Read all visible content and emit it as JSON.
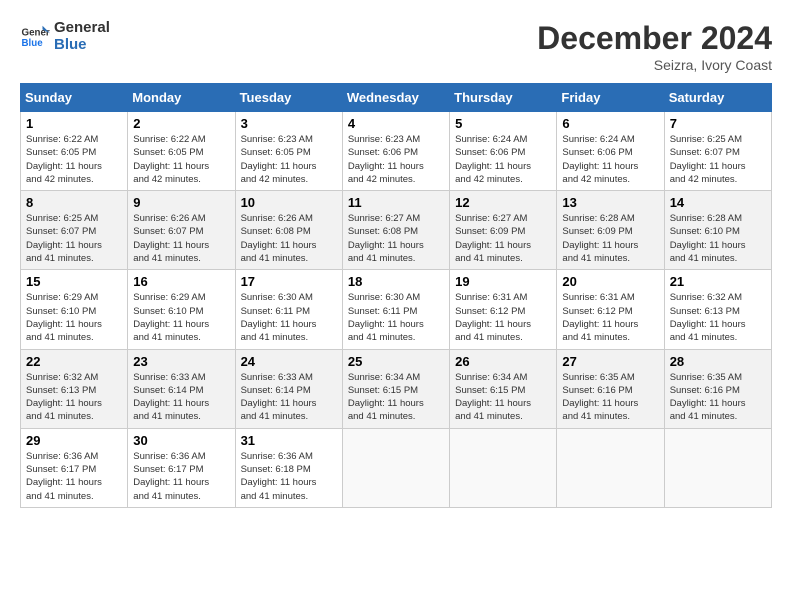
{
  "logo": {
    "line1": "General",
    "line2": "Blue"
  },
  "title": "December 2024",
  "location": "Seizra, Ivory Coast",
  "days_of_week": [
    "Sunday",
    "Monday",
    "Tuesday",
    "Wednesday",
    "Thursday",
    "Friday",
    "Saturday"
  ],
  "weeks": [
    [
      {
        "day": "1",
        "info": "Sunrise: 6:22 AM\nSunset: 6:05 PM\nDaylight: 11 hours\nand 42 minutes."
      },
      {
        "day": "2",
        "info": "Sunrise: 6:22 AM\nSunset: 6:05 PM\nDaylight: 11 hours\nand 42 minutes."
      },
      {
        "day": "3",
        "info": "Sunrise: 6:23 AM\nSunset: 6:05 PM\nDaylight: 11 hours\nand 42 minutes."
      },
      {
        "day": "4",
        "info": "Sunrise: 6:23 AM\nSunset: 6:06 PM\nDaylight: 11 hours\nand 42 minutes."
      },
      {
        "day": "5",
        "info": "Sunrise: 6:24 AM\nSunset: 6:06 PM\nDaylight: 11 hours\nand 42 minutes."
      },
      {
        "day": "6",
        "info": "Sunrise: 6:24 AM\nSunset: 6:06 PM\nDaylight: 11 hours\nand 42 minutes."
      },
      {
        "day": "7",
        "info": "Sunrise: 6:25 AM\nSunset: 6:07 PM\nDaylight: 11 hours\nand 42 minutes."
      }
    ],
    [
      {
        "day": "8",
        "info": "Sunrise: 6:25 AM\nSunset: 6:07 PM\nDaylight: 11 hours\nand 41 minutes."
      },
      {
        "day": "9",
        "info": "Sunrise: 6:26 AM\nSunset: 6:07 PM\nDaylight: 11 hours\nand 41 minutes."
      },
      {
        "day": "10",
        "info": "Sunrise: 6:26 AM\nSunset: 6:08 PM\nDaylight: 11 hours\nand 41 minutes."
      },
      {
        "day": "11",
        "info": "Sunrise: 6:27 AM\nSunset: 6:08 PM\nDaylight: 11 hours\nand 41 minutes."
      },
      {
        "day": "12",
        "info": "Sunrise: 6:27 AM\nSunset: 6:09 PM\nDaylight: 11 hours\nand 41 minutes."
      },
      {
        "day": "13",
        "info": "Sunrise: 6:28 AM\nSunset: 6:09 PM\nDaylight: 11 hours\nand 41 minutes."
      },
      {
        "day": "14",
        "info": "Sunrise: 6:28 AM\nSunset: 6:10 PM\nDaylight: 11 hours\nand 41 minutes."
      }
    ],
    [
      {
        "day": "15",
        "info": "Sunrise: 6:29 AM\nSunset: 6:10 PM\nDaylight: 11 hours\nand 41 minutes."
      },
      {
        "day": "16",
        "info": "Sunrise: 6:29 AM\nSunset: 6:10 PM\nDaylight: 11 hours\nand 41 minutes."
      },
      {
        "day": "17",
        "info": "Sunrise: 6:30 AM\nSunset: 6:11 PM\nDaylight: 11 hours\nand 41 minutes."
      },
      {
        "day": "18",
        "info": "Sunrise: 6:30 AM\nSunset: 6:11 PM\nDaylight: 11 hours\nand 41 minutes."
      },
      {
        "day": "19",
        "info": "Sunrise: 6:31 AM\nSunset: 6:12 PM\nDaylight: 11 hours\nand 41 minutes."
      },
      {
        "day": "20",
        "info": "Sunrise: 6:31 AM\nSunset: 6:12 PM\nDaylight: 11 hours\nand 41 minutes."
      },
      {
        "day": "21",
        "info": "Sunrise: 6:32 AM\nSunset: 6:13 PM\nDaylight: 11 hours\nand 41 minutes."
      }
    ],
    [
      {
        "day": "22",
        "info": "Sunrise: 6:32 AM\nSunset: 6:13 PM\nDaylight: 11 hours\nand 41 minutes."
      },
      {
        "day": "23",
        "info": "Sunrise: 6:33 AM\nSunset: 6:14 PM\nDaylight: 11 hours\nand 41 minutes."
      },
      {
        "day": "24",
        "info": "Sunrise: 6:33 AM\nSunset: 6:14 PM\nDaylight: 11 hours\nand 41 minutes."
      },
      {
        "day": "25",
        "info": "Sunrise: 6:34 AM\nSunset: 6:15 PM\nDaylight: 11 hours\nand 41 minutes."
      },
      {
        "day": "26",
        "info": "Sunrise: 6:34 AM\nSunset: 6:15 PM\nDaylight: 11 hours\nand 41 minutes."
      },
      {
        "day": "27",
        "info": "Sunrise: 6:35 AM\nSunset: 6:16 PM\nDaylight: 11 hours\nand 41 minutes."
      },
      {
        "day": "28",
        "info": "Sunrise: 6:35 AM\nSunset: 6:16 PM\nDaylight: 11 hours\nand 41 minutes."
      }
    ],
    [
      {
        "day": "29",
        "info": "Sunrise: 6:36 AM\nSunset: 6:17 PM\nDaylight: 11 hours\nand 41 minutes."
      },
      {
        "day": "30",
        "info": "Sunrise: 6:36 AM\nSunset: 6:17 PM\nDaylight: 11 hours\nand 41 minutes."
      },
      {
        "day": "31",
        "info": "Sunrise: 6:36 AM\nSunset: 6:18 PM\nDaylight: 11 hours\nand 41 minutes."
      },
      {
        "day": "",
        "info": ""
      },
      {
        "day": "",
        "info": ""
      },
      {
        "day": "",
        "info": ""
      },
      {
        "day": "",
        "info": ""
      }
    ]
  ]
}
